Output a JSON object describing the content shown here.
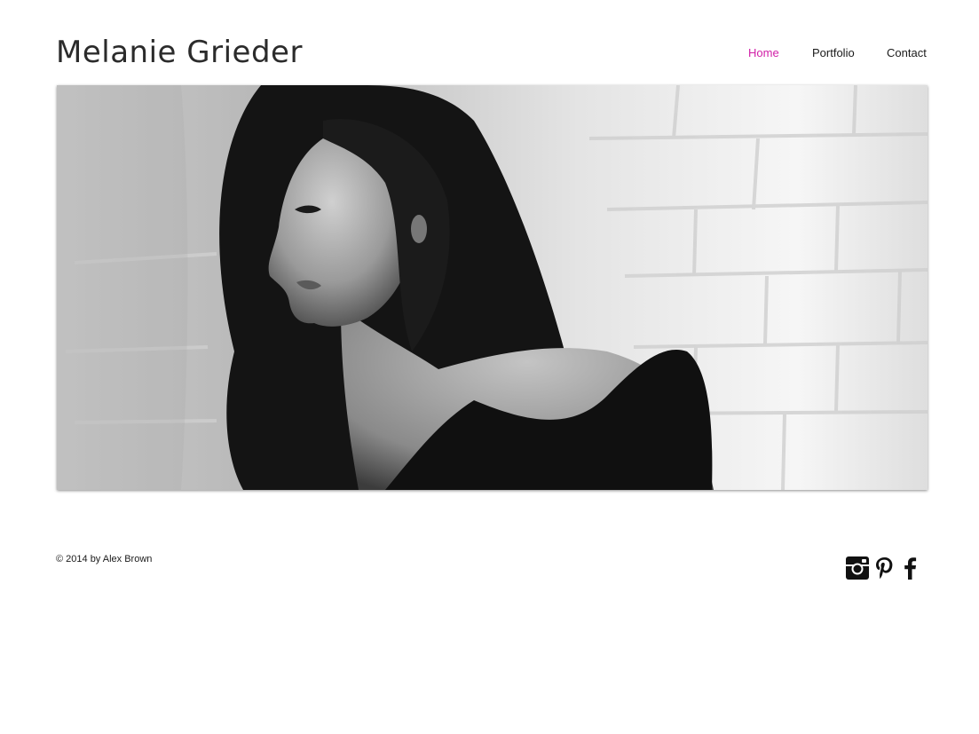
{
  "site": {
    "title": "Melanie Grieder"
  },
  "nav": {
    "items": [
      {
        "label": "Home",
        "active": true
      },
      {
        "label": "Portfolio",
        "active": false
      },
      {
        "label": "Contact",
        "active": false
      }
    ],
    "active_color": "#d11fa7"
  },
  "hero": {
    "image": "black-and-white-portrait-woman-long-hair-brick-wall"
  },
  "footer": {
    "copyright": "© 2014 by Alex Brown",
    "social": [
      {
        "icon": "instagram-icon"
      },
      {
        "icon": "pinterest-icon"
      },
      {
        "icon": "facebook-icon"
      }
    ]
  }
}
